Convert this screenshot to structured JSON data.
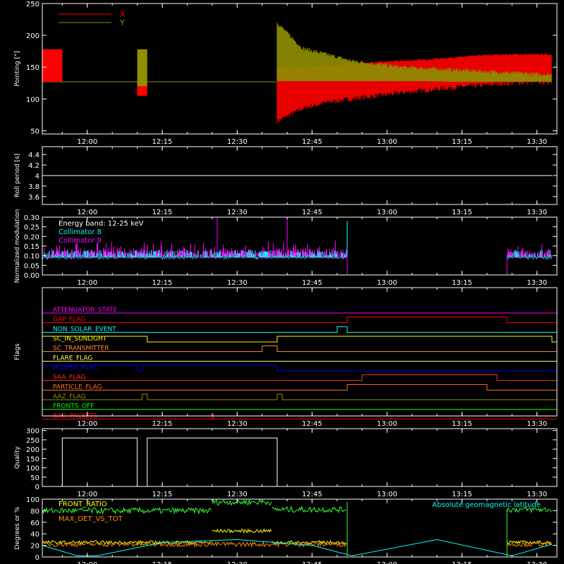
{
  "chart_data": [
    {
      "type": "line",
      "ylabel": "Pointing [\"]",
      "ylim": [
        45,
        250
      ],
      "yticks": [
        50,
        100,
        150,
        200,
        250
      ],
      "xticks": [
        "12:00",
        "12:15",
        "12:30",
        "12:45",
        "13:00",
        "13:15",
        "13:30"
      ],
      "legend": [
        {
          "label": "X",
          "color": "#ff0000"
        },
        {
          "label": "Y",
          "color": "#8f8f00"
        }
      ],
      "baseline": 127,
      "segments": [
        {
          "series": "Y",
          "start": "11:51",
          "end": "11:55",
          "low": 127,
          "high": 172
        },
        {
          "series": "X",
          "start": "11:51",
          "end": "11:55",
          "low": 127,
          "high": 178
        },
        {
          "series": "X",
          "start": "12:10",
          "end": "12:12",
          "low": 105,
          "high": 130
        },
        {
          "series": "Y",
          "start": "12:10",
          "end": "12:12",
          "low": 120,
          "high": 178
        }
      ],
      "envelope": {
        "start": "12:38",
        "end": "13:33",
        "y_high": [
          220,
          180,
          170,
          160,
          155,
          150,
          148,
          146,
          144,
          142,
          140,
          138
        ],
        "y_low": [
          128,
          128,
          128,
          128,
          128,
          128,
          128,
          127,
          127,
          127,
          127,
          127
        ],
        "x_high": [
          150,
          150,
          152,
          155,
          158,
          160,
          162,
          165,
          168,
          170,
          170,
          170
        ],
        "x_low": [
          65,
          85,
          95,
          100,
          105,
          110,
          114,
          118,
          121,
          124,
          126,
          127
        ]
      }
    },
    {
      "type": "line",
      "ylabel": "Roll period [s]",
      "ylim": [
        3.45,
        4.55
      ],
      "yticks": [
        3.6,
        3.8,
        4.0,
        4.2,
        4.4
      ],
      "xticks": [
        "12:00",
        "12:15",
        "12:30",
        "12:45",
        "13:00",
        "13:15",
        "13:30"
      ],
      "series": [
        {
          "value": 4.0,
          "start": "11:51",
          "end": "13:33",
          "color": "#ffffff"
        }
      ]
    },
    {
      "type": "line",
      "ylabel": "Normalized modulation",
      "ylim": [
        0.0,
        0.3
      ],
      "yticks": [
        "0.00",
        "0.05",
        "0.10",
        "0.15",
        "0.20",
        "0.25",
        "0.30"
      ],
      "xticks": [
        "12:00",
        "12:15",
        "12:30",
        "12:45",
        "13:00",
        "13:15",
        "13:30"
      ],
      "legend": [
        {
          "label": "Energy band: 12-25 keV",
          "color": "#ffffff"
        },
        {
          "label": "Collimator 8",
          "color": "#00ffff"
        },
        {
          "label": "Collimator 9",
          "color": "#ff00ff"
        }
      ],
      "noise_intervals": [
        {
          "start": "11:51",
          "end": "12:52"
        },
        {
          "start": "13:24",
          "end": "13:33"
        }
      ],
      "zero_interval": {
        "start": "12:52",
        "end": "13:24"
      },
      "spikes": [
        {
          "series": "Collimator 9",
          "time": "12:26",
          "value": 0.3
        },
        {
          "series": "Collimator 9",
          "time": "12:40",
          "value": 0.29
        },
        {
          "series": "Collimator 8",
          "time": "12:52",
          "value": 0.28
        }
      ]
    },
    {
      "type": "line",
      "ylabel": "Flags",
      "xticks": [
        "12:00",
        "12:15",
        "12:30",
        "12:45",
        "13:00",
        "13:15",
        "13:30"
      ],
      "flags": [
        {
          "name": "ATTENUATOR_STATE",
          "color": "#ff00ff",
          "pulses": []
        },
        {
          "name": "GAP_FLAG",
          "color": "#ff0000",
          "pulses": [
            [
              "12:52",
              "13:24"
            ]
          ]
        },
        {
          "name": "NON_SOLAR_EVENT",
          "color": "#00ffff",
          "pulses": [
            [
              "12:50",
              "12:52"
            ]
          ]
        },
        {
          "name": "SC_IN_SUNLIGHT",
          "color": "#ffff00",
          "pulses": [
            [
              "11:51",
              "12:12"
            ],
            [
              "12:38",
              "13:33"
            ]
          ]
        },
        {
          "name": "SC_TRANSMITTER",
          "color": "#ff8c40",
          "pulses": [
            [
              "12:35",
              "12:38"
            ]
          ]
        },
        {
          "name": "FLARE_FLAG",
          "color": "#ffff66",
          "pulses": []
        },
        {
          "name": "ECLIPSE_FLAG",
          "color": "#0000ff",
          "pulses": [
            [
              "11:51",
              "12:10"
            ],
            [
              "12:11",
              "12:38"
            ]
          ]
        },
        {
          "name": "SAA_FLAG",
          "color": "#ff3030",
          "pulses": [
            [
              "12:55",
              "13:22"
            ]
          ]
        },
        {
          "name": "PARTICLE_FLAG",
          "color": "#ff7020",
          "pulses": [
            [
              "12:52",
              "13:20"
            ]
          ]
        },
        {
          "name": "AAZ_FLAG",
          "color": "#8f8f00",
          "pulses": [
            [
              "12:11",
              "12:12"
            ],
            [
              "12:38",
              "12:39"
            ]
          ]
        },
        {
          "name": "FRONTS_OFF",
          "color": "#00ff00",
          "pulses": []
        },
        {
          "name": "BAD_PACKETS",
          "color": "#ff0000",
          "pulses": [
            [
              "12:25",
              "12:25"
            ]
          ]
        }
      ]
    },
    {
      "type": "line",
      "ylabel": "Quality",
      "ylim": [
        0,
        310
      ],
      "yticks": [
        0,
        50,
        100,
        150,
        200,
        250,
        300
      ],
      "xticks": [
        "12:00",
        "12:15",
        "12:30",
        "12:45",
        "13:00",
        "13:15",
        "13:30"
      ],
      "steps": [
        {
          "start": "11:55",
          "end": "12:10",
          "value": 260
        },
        {
          "start": "12:12",
          "end": "12:38",
          "value": 260
        }
      ]
    },
    {
      "type": "line",
      "ylabel": "Degrees or %",
      "ylim": [
        0,
        100
      ],
      "yticks": [
        0,
        20,
        40,
        60,
        80,
        100
      ],
      "xticks": [
        "12:00",
        "12:15",
        "12:30",
        "12:45",
        "13:00",
        "13:15",
        "13:30"
      ],
      "legend": [
        {
          "label": "FRONT_RATIO",
          "color": "#ffff00"
        },
        {
          "label": "MAX_DET_VS_TOT",
          "color": "#ff8c00"
        },
        {
          "label": "Absolute geomagnetic latitude",
          "color": "#00ffff"
        }
      ],
      "front_ratio_green": [
        {
          "start": "11:51",
          "end": "12:25",
          "value": 80
        },
        {
          "start": "12:25",
          "end": "12:37",
          "value": 95
        },
        {
          "start": "12:37",
          "end": "12:52",
          "value": 82
        },
        {
          "start": "13:24",
          "end": "13:33",
          "value": 82
        }
      ],
      "front_ratio_yellow": [
        {
          "start": "11:51",
          "end": "12:25",
          "value": 25
        },
        {
          "start": "12:25",
          "end": "12:37",
          "value": 45
        },
        {
          "start": "12:37",
          "end": "12:52",
          "value": 25
        },
        {
          "start": "13:24",
          "end": "13:33",
          "value": 25
        }
      ],
      "max_det_vs_tot": [
        {
          "start": "11:51",
          "end": "12:52",
          "value": 22
        },
        {
          "start": "13:24",
          "end": "13:33",
          "value": 22
        }
      ],
      "geomagnetic_latitude": [
        [
          "11:51",
          20
        ],
        [
          "11:58",
          2
        ],
        [
          "12:02",
          2
        ],
        [
          "12:15",
          25
        ],
        [
          "12:30",
          30
        ],
        [
          "12:45",
          20
        ],
        [
          "12:53",
          2
        ],
        [
          "13:10",
          30
        ],
        [
          "13:25",
          2
        ],
        [
          "13:33",
          22
        ]
      ]
    }
  ]
}
